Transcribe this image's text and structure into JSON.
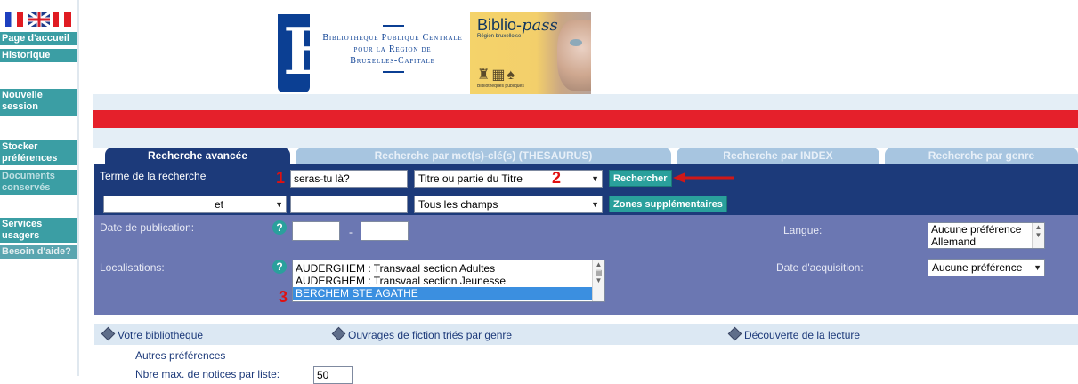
{
  "sidebar": {
    "flags": [
      "fr",
      "en",
      "it"
    ],
    "items": [
      {
        "label": "Page d'accueil"
      },
      {
        "label": "Historique"
      },
      {
        "label": "Nouvelle session"
      },
      {
        "label": "Stocker préférences"
      },
      {
        "label": "Documents conservés"
      },
      {
        "label": "Services usagers"
      },
      {
        "label": "Besoin d'aide?"
      }
    ]
  },
  "banner": {
    "logo_letter": "B",
    "library_name_1": "Bibliotheque Publique Centrale",
    "library_name_2": "pour la Region de",
    "library_name_3": "Bruxelles-Capitale",
    "biblio_pass_title": "Biblio-",
    "biblio_pass_italic": "pass",
    "biblio_pass_sub": "Région bruxelloise",
    "biblio_pass_small": "Bibliothèques publiques"
  },
  "tabs": [
    {
      "label": "Recherche avancée",
      "active": true
    },
    {
      "label": "Recherche par mot(s)-clé(s) (THESAURUS)",
      "active": false
    },
    {
      "label": "Recherche par INDEX",
      "active": false
    },
    {
      "label": "Recherche par genre",
      "active": false
    }
  ],
  "form": {
    "term_label": "Terme de la recherche",
    "term_value": "seras-tu là?",
    "field_select_1": "Titre ou partie du Titre",
    "search_button": "Rechercher",
    "operator_select": "et",
    "term2_value": "",
    "field_select_2": "Tous les champs",
    "more_zones_button": "Zones supplémentaires",
    "date_label": "Date de publication:",
    "date_sep": "-",
    "langue_label": "Langue:",
    "langue_options": [
      "Aucune préférence",
      "Allemand"
    ],
    "localisations_label": "Localisations:",
    "localisations_options": [
      "AUDERGHEM : Transvaal section Adultes",
      "AUDERGHEM : Transvaal section Jeunesse",
      "BERCHEM STE AGATHE"
    ],
    "acquisition_label": "Date d'acquisition:",
    "acquisition_select": "Aucune préférence",
    "help_symbol": "?"
  },
  "annotations": {
    "one": "1",
    "two": "2",
    "three": "3"
  },
  "bottom": {
    "links": [
      "Votre bibliothèque",
      "Ouvrages de fiction triés par genre",
      "Découverte de la lecture"
    ],
    "other_prefs": "Autres préférences",
    "max_notices_label": "Nbre max. de notices par liste:",
    "max_notices_value": "50"
  },
  "colors": {
    "accent_red": "#e5202b",
    "navy": "#1c3a7a",
    "teal": "#2aa09c",
    "form_light": "#6b77b2"
  }
}
